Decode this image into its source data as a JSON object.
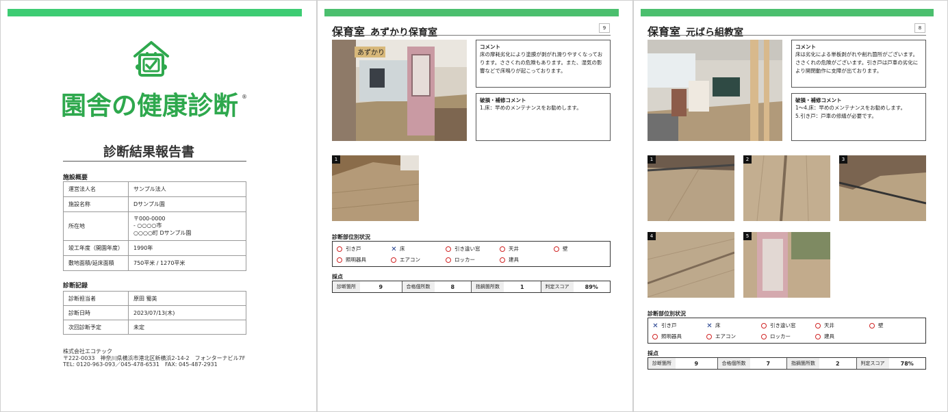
{
  "cover": {
    "logo_text": "園舎の健康診断",
    "logo_reg": "®",
    "report_title": "診断結果報告書",
    "facility_section": "施設概要",
    "facility_rows": [
      {
        "label": "運営法人名",
        "value": "サンプル法人"
      },
      {
        "label": "施設名称",
        "value": "Dサンプル園"
      },
      {
        "label": "所在地",
        "lines": [
          "〒000-0000",
          "- ○○○○市",
          "○○○○町 Dサンプル園"
        ]
      },
      {
        "label": "竣工年度（開園年度）",
        "value": "1990年"
      },
      {
        "label": "敷地面積/延床面積",
        "value": "750平米 / 1270平米"
      }
    ],
    "record_section": "診断記録",
    "record_rows": [
      {
        "label": "診断担当者",
        "value": "原田 蜀英"
      },
      {
        "label": "診断日時",
        "value": "2023/07/13(木)"
      },
      {
        "label": "次回診断予定",
        "value": "未定"
      }
    ],
    "company": [
      "株式会社エコテック",
      "〒222-0033　神奈川県横浜市港北区新横浜2-14-2　フォンターナビル7F",
      "TEL: 0120-963-093／045-478-6531　FAX: 045-487-2931"
    ]
  },
  "page_a": {
    "room": "保育室",
    "room_name": "あずかり保育室",
    "page_number": "9",
    "door_sign": "あずかり",
    "comment_title": "コメント",
    "comment_text": "床の摩耗劣化により塗膜が剥がれ滑りやすくなっております。ささくれの危険もあります。また、湿気の影響などで床鳴りが起こっております。",
    "repair_title": "破損・補修コメント",
    "repair_text": "1.床：早めのメンテナンスをお勧めします。",
    "photo_tags": [
      "1"
    ],
    "status_title": "診断部位別状況",
    "status": [
      {
        "label": "引き戸",
        "mark": "o"
      },
      {
        "label": "床",
        "mark": "x"
      },
      {
        "label": "引き違い窓",
        "mark": "o"
      },
      {
        "label": "天井",
        "mark": "o"
      },
      {
        "label": "壁",
        "mark": "o"
      },
      {
        "label": "照明器具",
        "mark": "o"
      },
      {
        "label": "エアコン",
        "mark": "o"
      },
      {
        "label": "ロッカー",
        "mark": "o"
      },
      {
        "label": "建具",
        "mark": "o"
      }
    ],
    "score_title": "採点",
    "scores": [
      {
        "label": "診断箇所",
        "value": "9"
      },
      {
        "label": "合格個所数",
        "value": "8"
      },
      {
        "label": "指摘箇所数",
        "value": "1"
      },
      {
        "label": "判定スコア",
        "value": "89%"
      }
    ]
  },
  "page_b": {
    "room": "保育室",
    "room_name": "元ばら組教室",
    "page_number": "8",
    "comment_title": "コメント",
    "comment_text": "床は劣化による単板剥がれや削れ箇所がございます。ささくれの危険がございます。引き戸は戸車の劣化により開閉動作に支障が出ております。",
    "repair_title": "破損・補修コメント",
    "repair_text1": "1〜4.床：早めのメンテナンスをお勧めします。",
    "repair_text2": "5.引き戸：戸車の修繕が必要です。",
    "photo_tags": [
      "1",
      "2",
      "3",
      "4",
      "5"
    ],
    "status_title": "診断部位別状況",
    "status": [
      {
        "label": "引き戸",
        "mark": "x"
      },
      {
        "label": "床",
        "mark": "x"
      },
      {
        "label": "引き違い窓",
        "mark": "o"
      },
      {
        "label": "天井",
        "mark": "o"
      },
      {
        "label": "壁",
        "mark": "o"
      },
      {
        "label": "照明器具",
        "mark": "o"
      },
      {
        "label": "エアコン",
        "mark": "o"
      },
      {
        "label": "ロッカー",
        "mark": "o"
      },
      {
        "label": "建具",
        "mark": "o"
      }
    ],
    "score_title": "採点",
    "scores": [
      {
        "label": "診断箇所",
        "value": "9"
      },
      {
        "label": "合格個所数",
        "value": "7"
      },
      {
        "label": "指摘箇所数",
        "value": "2"
      },
      {
        "label": "判定スコア",
        "value": "78%"
      }
    ]
  },
  "icons": {
    "marks": [
      "circle-ok-icon",
      "x-defect-icon"
    ]
  },
  "colors": {
    "brand_green": "#2ea84d",
    "bar_green": "#4bbf6e",
    "ok_red": "#d02323",
    "defect_blue": "#1c3a8a"
  }
}
